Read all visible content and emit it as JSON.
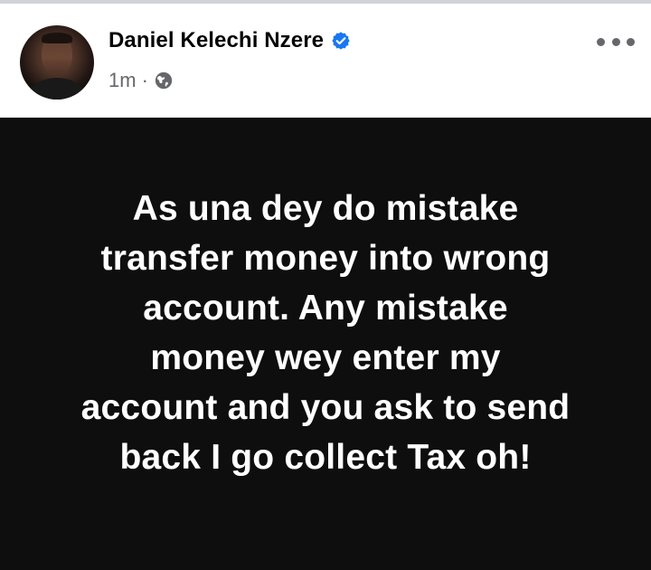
{
  "author": {
    "name": "Daniel Kelechi Nzere",
    "verified_icon": "verified-badge-icon",
    "avatar": "profile-photo"
  },
  "meta": {
    "time": "1m",
    "separator": "·",
    "audience_icon": "globe-icon"
  },
  "menu": {
    "icon": "more-options-icon"
  },
  "post": {
    "background_color": "#0e0e0e",
    "text_color": "#ffffff",
    "lines": [
      "As una dey do mistake",
      "transfer money into wrong",
      "account. Any mistake",
      "money wey enter my",
      "account and you ask to send",
      "back I go collect Tax oh!"
    ]
  },
  "colors": {
    "verified_blue": "#1877f2",
    "meta_gray": "#65676b"
  }
}
